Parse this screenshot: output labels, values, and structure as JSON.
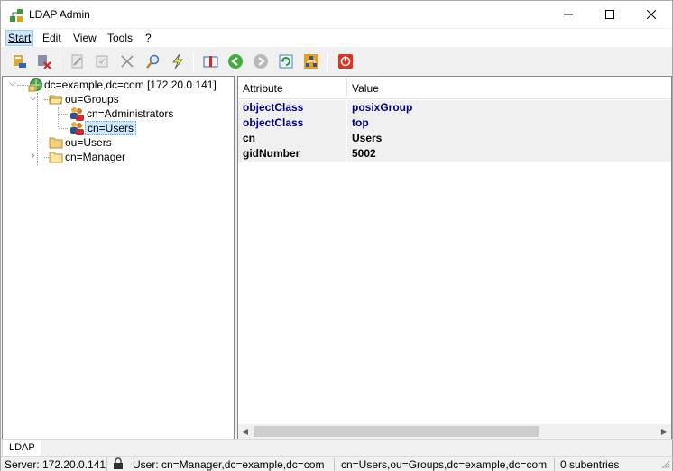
{
  "window": {
    "title": "LDAP Admin",
    "app_icon": "ldap-admin-icon",
    "controls": {
      "minimize": "–",
      "maximize": "☐",
      "close": "✕"
    }
  },
  "menu": {
    "items": [
      {
        "label": "Start",
        "active": true
      },
      {
        "label": "Edit",
        "active": false
      },
      {
        "label": "View",
        "active": false
      },
      {
        "label": "Tools",
        "active": false
      },
      {
        "label": "?",
        "active": false
      }
    ]
  },
  "toolbar": {
    "buttons": [
      "connect-icon",
      "disconnect-icon",
      "edit-entry-icon",
      "properties-icon",
      "delete-icon",
      "search-icon",
      "lightning-icon",
      "schema-book-icon",
      "back-arrow-icon",
      "forward-arrow-icon",
      "refresh-icon",
      "directory-tree-icon",
      "exit-icon"
    ]
  },
  "tree": {
    "root": "dc=example,dc=com [172.20.0.141]",
    "groups": "ou=Groups",
    "administrators": "cn=Administrators",
    "users_group": "cn=Users",
    "users_ou": "ou=Users",
    "manager": "cn=Manager"
  },
  "attributes": {
    "header_attribute": "Attribute",
    "header_value": "Value",
    "rows": [
      {
        "name": "objectClass",
        "value": "posixGroup"
      },
      {
        "name": "objectClass",
        "value": "top"
      },
      {
        "name": "cn",
        "value": "Users"
      },
      {
        "name": "gidNumber",
        "value": "5002"
      }
    ]
  },
  "tabs": {
    "ldap": "LDAP"
  },
  "status": {
    "server": "Server: 172.20.0.141",
    "user": "User: cn=Manager,dc=example,dc=com",
    "dn": "cn=Users,ou=Groups,dc=example,dc=com",
    "subentries": "0 subentries"
  },
  "colors": {
    "selection": "#cce8ff",
    "attribute_blue": "#000080",
    "folder_yellow": "#f4d27a"
  }
}
